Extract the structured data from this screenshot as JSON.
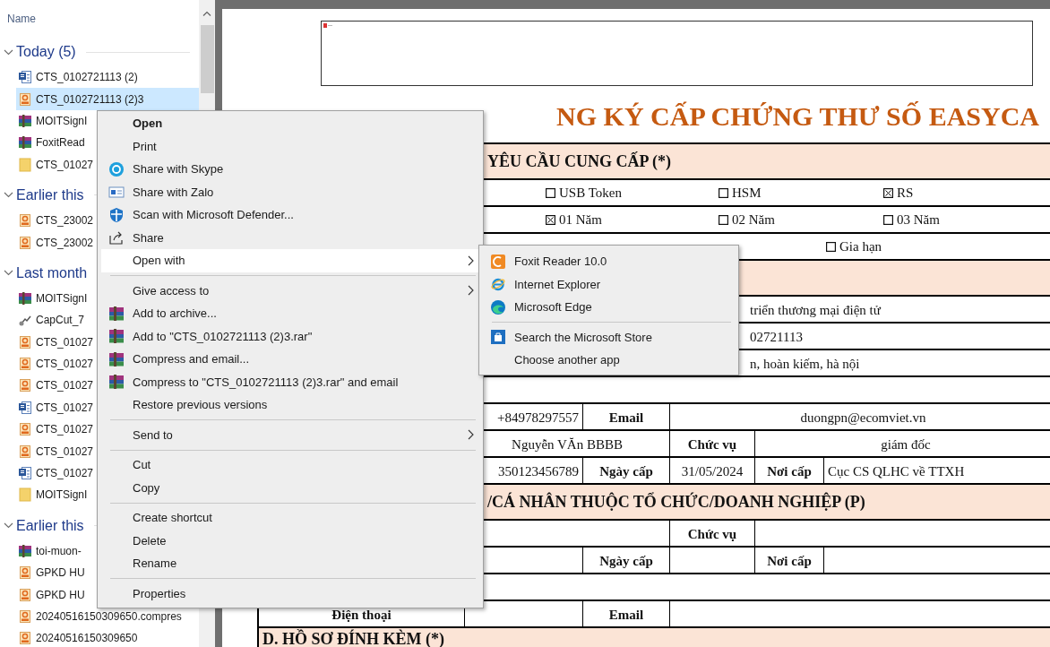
{
  "files": {
    "column_header": "Name",
    "groups": [
      {
        "label": "Today (5)",
        "expanded": true,
        "items": [
          {
            "name": "CTS_0102721113 (2)",
            "kind": "word",
            "selected": false
          },
          {
            "name": "CTS_0102721113 (2)3",
            "kind": "pdf",
            "selected": true
          },
          {
            "name": "MOITSignI",
            "kind": "archive",
            "selected": false
          },
          {
            "name": "FoxitRead",
            "kind": "archive",
            "selected": false
          },
          {
            "name": "CTS_01027",
            "kind": "folder",
            "selected": false
          }
        ]
      },
      {
        "label": "Earlier this",
        "expanded": true,
        "items": [
          {
            "name": "CTS_23002",
            "kind": "pdf",
            "selected": false
          },
          {
            "name": "CTS_23002",
            "kind": "pdf",
            "selected": false
          }
        ]
      },
      {
        "label": "Last month",
        "expanded": true,
        "items": [
          {
            "name": "MOITSignI",
            "kind": "archive",
            "selected": false
          },
          {
            "name": "CapCut_7",
            "kind": "installer",
            "selected": false
          },
          {
            "name": "CTS_01027",
            "kind": "pdf",
            "selected": false
          },
          {
            "name": "CTS_01027",
            "kind": "pdf",
            "selected": false
          },
          {
            "name": "CTS_01027",
            "kind": "pdf",
            "selected": false
          },
          {
            "name": "CTS_01027",
            "kind": "word",
            "selected": false
          },
          {
            "name": "CTS_01027",
            "kind": "pdf",
            "selected": false
          },
          {
            "name": "CTS_01027",
            "kind": "pdf",
            "selected": false
          },
          {
            "name": "CTS_01027",
            "kind": "word",
            "selected": false
          },
          {
            "name": "MOITSignI",
            "kind": "folder",
            "selected": false
          }
        ]
      },
      {
        "label": "Earlier this",
        "expanded": true,
        "items": [
          {
            "name": "toi-muon-",
            "kind": "archive",
            "selected": false
          },
          {
            "name": "GPKD HU",
            "kind": "pdf",
            "selected": false
          },
          {
            "name": "GPKD HU",
            "kind": "pdf",
            "selected": false
          },
          {
            "name": "20240516150309650.compres",
            "kind": "pdf",
            "selected": false
          },
          {
            "name": "20240516150309650",
            "kind": "pdf",
            "selected": false
          }
        ]
      }
    ]
  },
  "document": {
    "title": "NG KÝ CẤP CHỨNG THƯ SỐ EASYCA",
    "rows": [
      {
        "kind": "section_cont",
        "text": "YÊU CẦU CUNG CẤP (*)"
      },
      {
        "kind": "options",
        "options": [
          {
            "label": "USB Token",
            "checked": false
          },
          {
            "label": "HSM",
            "checked": false
          },
          {
            "label": "RS",
            "checked": true
          }
        ]
      },
      {
        "kind": "options",
        "options": [
          {
            "label": "01 Năm",
            "checked": true
          },
          {
            "label": "02 Năm",
            "checked": false
          },
          {
            "label": "03 Năm",
            "checked": false
          }
        ]
      },
      {
        "kind": "options_tail",
        "options": [
          {
            "label": "Gia hạn",
            "checked": false
          }
        ]
      },
      {
        "kind": "section"
      },
      {
        "kind": "value",
        "text": "triển thương mại điện tử"
      },
      {
        "kind": "value",
        "text": "02721113"
      },
      {
        "kind": "value",
        "text": "n, hoàn kiếm, hà nội"
      },
      {
        "kind": "blank"
      },
      {
        "kind": "pair",
        "cells": [
          null,
          {
            "text": "+84978297557",
            "label": false
          },
          {
            "text": "Email",
            "label": true
          },
          {
            "text": "duongpn@ecomviet.vn",
            "label": false
          }
        ]
      },
      {
        "kind": "wide",
        "cells": [
          null,
          {
            "text": "Nguyễn VĂn BBBB",
            "label": false
          },
          {
            "text": "Chức vụ",
            "label": true
          },
          {
            "text": "giám đốc",
            "label": false
          }
        ]
      },
      {
        "kind": "grid",
        "cells": [
          null,
          {
            "text": "350123456789",
            "label": false
          },
          {
            "text": "Ngày cấp",
            "label": true
          },
          {
            "text": "31/05/2024",
            "label": false
          },
          {
            "text": "Nơi cấp",
            "label": true
          },
          {
            "text": "Cục CS QLHC về TTXH",
            "label": false
          }
        ]
      },
      {
        "kind": "section_cont",
        "text": "/CÁ NHÂN THUỘC TỔ CHỨC/DOANH NGHIỆP (P)"
      },
      {
        "kind": "wide",
        "cells": [
          null,
          null,
          {
            "text": "Chức vụ",
            "label": true
          },
          null
        ]
      },
      {
        "kind": "grid",
        "cells": [
          null,
          null,
          {
            "text": "Ngày cấp",
            "label": true
          },
          null,
          {
            "text": "Nơi cấp",
            "label": true
          },
          null
        ]
      },
      {
        "kind": "blank"
      },
      {
        "kind": "pair",
        "cells": [
          {
            "text": "Điện thoại",
            "label": true
          },
          null,
          {
            "text": "Email",
            "label": true
          },
          null
        ]
      },
      {
        "kind": "section",
        "text": "D. HỒ SƠ ĐÍNH KÈM (*)"
      }
    ]
  },
  "context_menu": {
    "items": [
      {
        "label": "Open",
        "kind": "plain",
        "selected": false,
        "default": true,
        "submenu": false
      },
      {
        "label": "Print",
        "kind": "plain",
        "selected": false,
        "default": false,
        "submenu": false
      },
      {
        "label": "Share with Skype",
        "kind": "chat",
        "selected": false,
        "default": false,
        "submenu": false
      },
      {
        "label": "Share with Zalo",
        "kind": "card",
        "selected": false,
        "default": false,
        "submenu": false
      },
      {
        "label": "Scan with Microsoft Defender...",
        "kind": "shield",
        "selected": false,
        "default": false,
        "submenu": false
      },
      {
        "label": "Share",
        "kind": "share",
        "selected": false,
        "default": false,
        "submenu": false
      },
      {
        "label": "Open with",
        "kind": "plain",
        "selected": true,
        "default": false,
        "submenu": true
      },
      {
        "kind": "separator"
      },
      {
        "label": "Give access to",
        "kind": "plain",
        "selected": false,
        "default": false,
        "submenu": true
      },
      {
        "label": "Add to archive...",
        "kind": "books",
        "selected": false,
        "default": false,
        "submenu": false
      },
      {
        "label": "Add to \"CTS_0102721113 (2)3.rar\"",
        "kind": "books",
        "selected": false,
        "default": false,
        "submenu": false
      },
      {
        "label": "Compress and email...",
        "kind": "books",
        "selected": false,
        "default": false,
        "submenu": false
      },
      {
        "label": "Compress to \"CTS_0102721113 (2)3.rar\" and email",
        "kind": "books",
        "selected": false,
        "default": false,
        "submenu": false
      },
      {
        "label": "Restore previous versions",
        "kind": "plain",
        "selected": false,
        "default": false,
        "submenu": false
      },
      {
        "kind": "separator"
      },
      {
        "label": "Send to",
        "kind": "plain",
        "selected": false,
        "default": false,
        "submenu": true
      },
      {
        "kind": "separator"
      },
      {
        "label": "Cut",
        "kind": "plain",
        "selected": false,
        "default": false,
        "submenu": false
      },
      {
        "label": "Copy",
        "kind": "plain",
        "selected": false,
        "default": false,
        "submenu": false
      },
      {
        "kind": "separator"
      },
      {
        "label": "Create shortcut",
        "kind": "plain",
        "selected": false,
        "default": false,
        "submenu": false
      },
      {
        "label": "Delete",
        "kind": "plain",
        "selected": false,
        "default": false,
        "submenu": false
      },
      {
        "label": "Rename",
        "kind": "plain",
        "selected": false,
        "default": false,
        "submenu": false
      },
      {
        "kind": "separator"
      },
      {
        "label": "Properties",
        "kind": "plain",
        "selected": false,
        "default": false,
        "submenu": false
      }
    ]
  },
  "submenu": {
    "items": [
      {
        "label": "Foxit Reader 10.0",
        "kind": "tile",
        "selected": false
      },
      {
        "label": "Internet Explorer",
        "kind": "browser",
        "selected": false
      },
      {
        "label": "Microsoft Edge",
        "kind": "swirl",
        "selected": false
      },
      {
        "kind": "separator"
      },
      {
        "label": "Search the Microsoft Store",
        "kind": "bag",
        "selected": false
      },
      {
        "label": "Choose another app",
        "kind": "plain",
        "selected": false
      }
    ]
  }
}
